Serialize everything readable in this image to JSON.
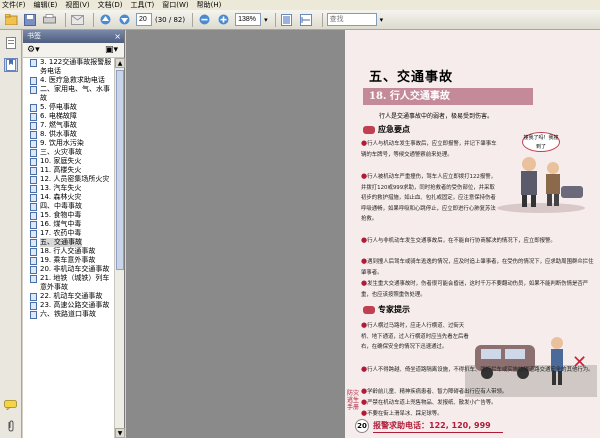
{
  "menubar": {
    "items": [
      "文件(F)",
      "编辑(E)",
      "视图(V)",
      "文档(D)",
      "工具(T)",
      "窗口(W)",
      "帮助(H)"
    ]
  },
  "toolbar": {
    "page_current": "20",
    "page_total": "(30 / 82)",
    "zoom": "138%",
    "find_placeholder": "查找"
  },
  "panel": {
    "title": "书签",
    "close": "×"
  },
  "bookmarks": [
    {
      "label": "3. 122交通事故报警服务电话",
      "selected": false
    },
    {
      "label": "4. 医疗急救求助电话",
      "selected": false
    },
    {
      "label": "二、家用电、气、水事故",
      "selected": false
    },
    {
      "label": "5. 停电事故",
      "selected": false
    },
    {
      "label": "6. 电梯故障",
      "selected": false
    },
    {
      "label": "7. 燃气事故",
      "selected": false
    },
    {
      "label": "8. 供水事故",
      "selected": false
    },
    {
      "label": "9. 饮用水污染",
      "selected": false
    },
    {
      "label": "三、火灾事故",
      "selected": false
    },
    {
      "label": "10. 家庭失火",
      "selected": false
    },
    {
      "label": "11. 高楼失火",
      "selected": false
    },
    {
      "label": "12. 人员密集场所火灾",
      "selected": false
    },
    {
      "label": "13. 汽车失火",
      "selected": false
    },
    {
      "label": "14. 森林火灾",
      "selected": false
    },
    {
      "label": "四、中毒事故",
      "selected": false
    },
    {
      "label": "15. 食物中毒",
      "selected": false
    },
    {
      "label": "16. 煤气中毒",
      "selected": false
    },
    {
      "label": "17. 农药中毒",
      "selected": false
    },
    {
      "label": "五、交通事故",
      "selected": true
    },
    {
      "label": "18. 行人交通事故",
      "selected": false
    },
    {
      "label": "19. 乘车意外事故",
      "selected": false
    },
    {
      "label": "20. 非机动车交通事故",
      "selected": false
    },
    {
      "label": "21. 地铁（城铁）列车意外事故",
      "selected": false
    },
    {
      "label": "22. 机动车交通事故",
      "selected": false
    },
    {
      "label": "23. 高速公路交通事故",
      "selected": false
    },
    {
      "label": "六、铁路道口事故",
      "selected": false
    }
  ],
  "doc": {
    "section_title": "五、交通事故",
    "sub_title": "18. 行人交通事故",
    "intro": "行人是交通事故中的弱者，极易受到伤害。",
    "bubble": "撞我了吗！我撞到了",
    "emergency_head": "应急要点",
    "emergency_paras": [
      "行人与机动车发生事故后，应立即报警，并记下肇事车辆的车牌号，等候交通警察前来处理。",
      "行人被机动车严重撞伤，驾车人应立即拨打122报警，并拨打120或999求助，同时抢救者的受伤部位，并采取初步的救护措施，如止血、包扎或固定，应注意保持伤者呼吸通畅，如果呼吸和心跳停止，应立即进行心肺复苏法抢救。",
      "行人与非机动车发生交通事故后，在不能自行协商解决的情况下，应立即报警。",
      "遇到撞人后驾车或骑车逃逸的情况，应及时追上肇事者，在受伤的情况下，应求助周围群众拦住肇事者。",
      "发生重大交通事故时，伤者很可能会昏迷，这时千万不要翻动伤员，如果不能判断伤情是否严重，也应该按照重伤处理。"
    ],
    "expert_head": "专家提示",
    "expert_paras": [
      "行人横过马路时，应走人行横道、过街天桥、地下通道，过人行横道时应当先看左后看右，在确保安全的情况下迅速通过。",
      "行人不得跨越、倚坐道路隔离设施，不得扒车、强行拦车或实施妨碍道路交通安全的其他行为。",
      "学龄前儿童、精神疾病患者、智力障碍者出行应有人带领。",
      "严禁在机动车道上兜售物品、发报纸、散发小广告等。",
      "不要在街上滑旱冰、踩足球等。"
    ],
    "side_label": "防灾逃生手册",
    "page_number": "20",
    "footer_text": "报警求助电话：122, 120, 999"
  }
}
